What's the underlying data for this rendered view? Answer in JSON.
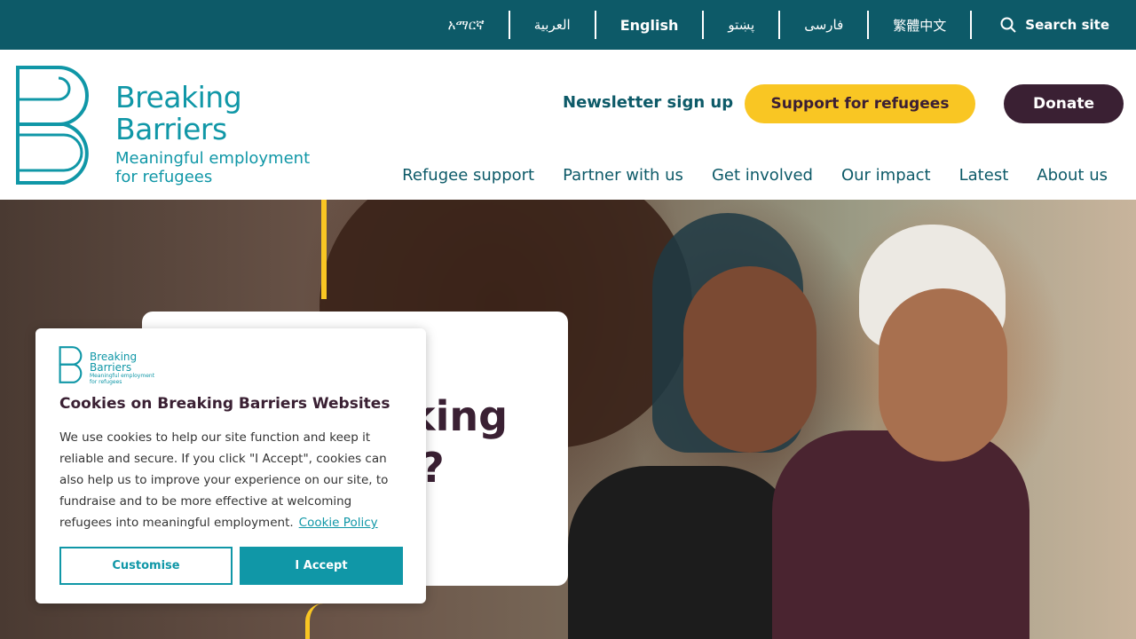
{
  "languages": [
    {
      "label": "አማርኛ"
    },
    {
      "label": "العربية"
    },
    {
      "label": "English"
    },
    {
      "label": "پښتو"
    },
    {
      "label": "فارسی"
    },
    {
      "label": "繁體中文"
    }
  ],
  "search": {
    "label": "Search site",
    "icon": "search-icon"
  },
  "logo": {
    "title_line1": "Breaking",
    "title_line2": "Barriers",
    "tagline_line1": "Meaningful employment",
    "tagline_line2": "for refugees"
  },
  "header": {
    "newsletter": "Newsletter sign up",
    "support": "Support for refugees",
    "donate": "Donate"
  },
  "nav": [
    "Refugee support",
    "Partner with us",
    "Get involved",
    "Our impact",
    "Latest",
    "About us"
  ],
  "hero": {
    "heading_line1": "king",
    "heading_line2": "?"
  },
  "cookie": {
    "logo_line1": "Breaking",
    "logo_line2": "Barriers",
    "logo_tag1": "Meaningful employment",
    "logo_tag2": "for refugees",
    "title": "Cookies on Breaking Barriers Websites",
    "body": "We use cookies to help our site function and keep it reliable and secure. If you click \"I Accept\", cookies can also help us to improve your experience on our site, to fundraise and to be more effective at welcoming refugees into meaningful employment.",
    "policy_link": "Cookie Policy",
    "customise": "Customise",
    "accept": "I Accept"
  },
  "colors": {
    "teal_dark": "#0d5a68",
    "teal": "#1097a7",
    "yellow": "#f9c623",
    "plum": "#3a2033"
  }
}
